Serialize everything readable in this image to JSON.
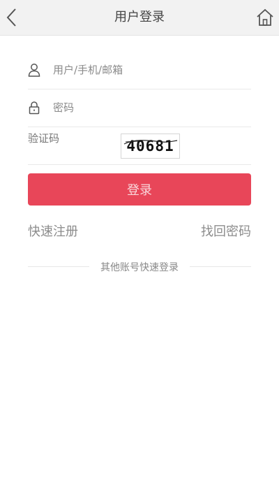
{
  "header": {
    "title": "用户登录",
    "back_icon": "chevron-left-icon",
    "home_icon": "home-icon"
  },
  "form": {
    "username": {
      "placeholder": "用户/手机/邮箱",
      "value": "",
      "icon": "user-icon"
    },
    "password": {
      "placeholder": "密码",
      "value": "",
      "icon": "lock-icon"
    },
    "captcha": {
      "placeholder": "验证码",
      "value": "",
      "image_text": "40681"
    }
  },
  "actions": {
    "login_label": "登录",
    "register_label": "快速注册",
    "forgot_label": "找回密码"
  },
  "other_login": {
    "label": "其他账号快速登录"
  },
  "colors": {
    "accent": "#e84659",
    "header_bg": "#f2f2f2"
  }
}
